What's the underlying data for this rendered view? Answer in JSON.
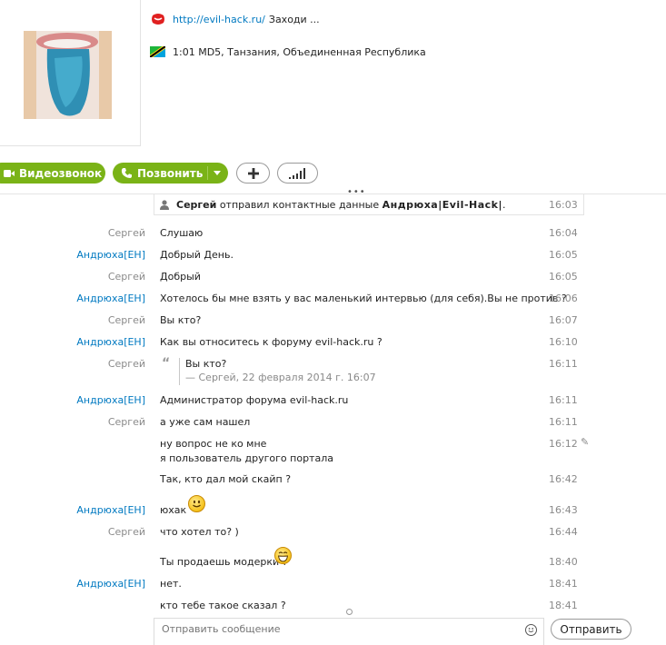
{
  "profile": {
    "mood_link": "http://evil-hack.ru/",
    "mood_text": "Заходи ...",
    "location": "1:01 MD5, Танзания, Объединенная Республика"
  },
  "toolbar": {
    "video_call_label": "Видеозвонок",
    "call_label": "Позвонить"
  },
  "system_message": {
    "sender": "Сергей",
    "action": " отправил контактные данные ",
    "contact": "Андрюха|Evil-Hack|",
    "tail": ".",
    "time": "16:03"
  },
  "messages": [
    {
      "sender": "Сергей",
      "text": "Слушаю",
      "time": "16:04"
    },
    {
      "sender": "Андрюха[EH]",
      "text": "Добрый День.",
      "time": "16:05"
    },
    {
      "sender": "Сергей",
      "text": "Добрый",
      "time": "16:05"
    },
    {
      "sender": "Андрюха[EH]",
      "text": "Хотелось бы мне взять у вас маленький интервью (для себя).Вы не против ?",
      "time": "16:06"
    },
    {
      "sender": "Сергей",
      "text": "Вы кто?",
      "time": "16:07"
    },
    {
      "sender": "Андрюха[EH]",
      "text": "Как вы относитесь к форуму evil-hack.ru ?",
      "time": "16:10"
    },
    {
      "sender": "Сергей",
      "text": "Вы кто?",
      "quote_meta": "— Сергей, 22 февраля 2014 г. 16:07",
      "time": "16:11"
    },
    {
      "sender": "Андрюха[EH]",
      "text": "Администратор форума evil-hack.ru",
      "time": "16:11"
    },
    {
      "sender": "Сергей",
      "text": "а уже сам нашел",
      "time": "16:11"
    },
    {
      "sender": "",
      "text": "ну вопрос не ко мне",
      "text2": "я пользователь другого портала",
      "time": "16:12"
    },
    {
      "sender": "",
      "text": "Так, кто дал мой скайп ?",
      "time": "16:42"
    },
    {
      "sender": "Андрюха[EH]",
      "text": "юхак",
      "time": "16:43"
    },
    {
      "sender": "Сергей",
      "text": "что хотел то? )",
      "time": "16:44"
    },
    {
      "sender": "",
      "text": "Ты продаешь модерки ?",
      "time": "18:40"
    },
    {
      "sender": "Андрюха[EH]",
      "text": "нет.",
      "time": "18:41"
    },
    {
      "sender": "",
      "text": "кто тебе такое сказал ?",
      "time": "18:41"
    }
  ],
  "composer": {
    "placeholder": "Отправить сообщение",
    "send_label": "Отправить"
  }
}
